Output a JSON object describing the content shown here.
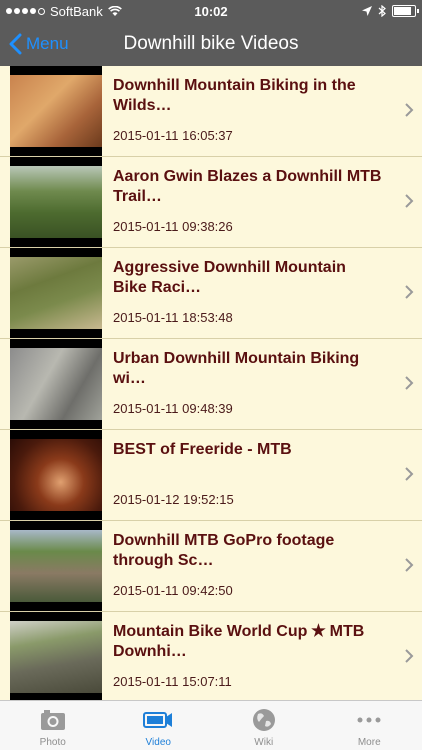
{
  "status_bar": {
    "carrier": "SoftBank",
    "time": "10:02"
  },
  "nav": {
    "back_label": "Menu",
    "title": "Downhill bike Videos"
  },
  "videos": [
    {
      "title": "Downhill Mountain Biking in the Wilds…",
      "date": "2015-01-11 16:05:37"
    },
    {
      "title": "Aaron Gwin Blazes a Downhill MTB Trail…",
      "date": "2015-01-11 09:38:26"
    },
    {
      "title": "Aggressive Downhill Mountain Bike Raci…",
      "date": "2015-01-11 18:53:48"
    },
    {
      "title": "Urban Downhill Mountain Biking wi…",
      "date": "2015-01-11 09:48:39"
    },
    {
      "title": "BEST of Freeride - MTB",
      "date": "2015-01-12 19:52:15"
    },
    {
      "title": "Downhill MTB GoPro footage through Sc…",
      "date": "2015-01-11 09:42:50"
    },
    {
      "title": "Mountain Bike World Cup ✭ MTB Downhi…",
      "date": "2015-01-11 15:07:11"
    }
  ],
  "tabs": [
    {
      "label": "Photo",
      "icon": "camera-icon",
      "active": false
    },
    {
      "label": "Video",
      "icon": "video-camera-icon",
      "active": true
    },
    {
      "label": "Wiki",
      "icon": "globe-icon",
      "active": false
    },
    {
      "label": "More",
      "icon": "more-dots-icon",
      "active": false
    }
  ],
  "colors": {
    "bar_bg": "#5b5b5b",
    "list_bg": "#fdf8dc",
    "title_text": "#5a1010",
    "accent": "#1e7fd8"
  }
}
